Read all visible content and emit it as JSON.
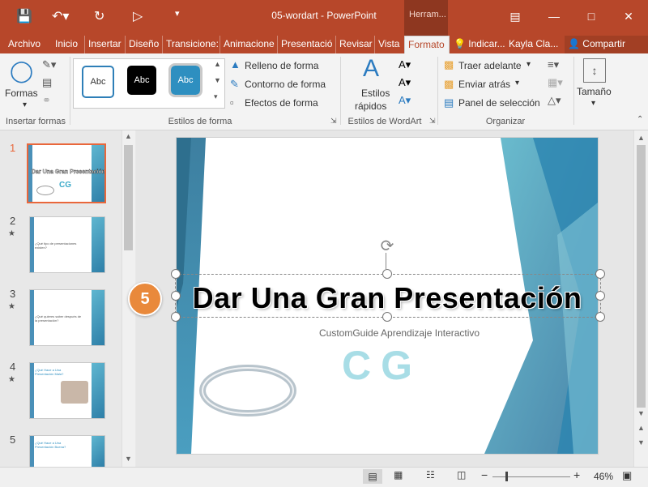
{
  "window": {
    "doc_title": "05-wordart  -  PowerPoint",
    "context_tab": "Herram...",
    "user": "Kayla Cla...",
    "share": "Compartir"
  },
  "tabs": [
    "Archivo",
    "Inicio",
    "Insertar",
    "Diseño",
    "Transicione:",
    "Animacione",
    "Presentació",
    "Revisar",
    "Vista",
    "Formato"
  ],
  "tell_me": "Indicar...",
  "ribbon": {
    "insertar_formas": {
      "label": "Insertar formas",
      "formas": "Formas"
    },
    "estilos_forma": {
      "label": "Estilos de forma",
      "samples": [
        "Abc",
        "Abc",
        "Abc"
      ],
      "relleno": "Relleno de forma",
      "contorno": "Contorno de forma",
      "efectos": "Efectos de forma"
    },
    "wordart": {
      "label": "Estilos de WordArt",
      "estilos": "Estilos",
      "rapidos": "rápidos"
    },
    "organizar": {
      "label": "Organizar",
      "traer": "Traer adelante",
      "enviar": "Enviar atrás",
      "panel": "Panel de selección"
    },
    "tamano": {
      "label": "Tamaño"
    }
  },
  "thumbnails": [
    {
      "num": "1",
      "title": "Dar Una Gran Presentación",
      "logo": "CG"
    },
    {
      "num": "2",
      "star": "★",
      "text": "¿Qué tipo de presentaciones existen?"
    },
    {
      "num": "3",
      "star": "★",
      "text": "¿Qué quieres saber después de la presentación?"
    },
    {
      "num": "4",
      "star": "★",
      "text": "¿Qué Hace a Una Presentación Mala?"
    },
    {
      "num": "5",
      "text": "¿Qué Hace a Una Presentación Buena?"
    }
  ],
  "slide": {
    "title": "Dar Una Gran Presentación",
    "subtitle": "CustomGuide Aprendizaje Interactivo",
    "logo": "CG"
  },
  "callout": "5",
  "status": {
    "zoom": "46%"
  },
  "colors": {
    "accent": "#b7472a",
    "callout": "#e9893b",
    "slide_teal": "#3a9bb8"
  }
}
